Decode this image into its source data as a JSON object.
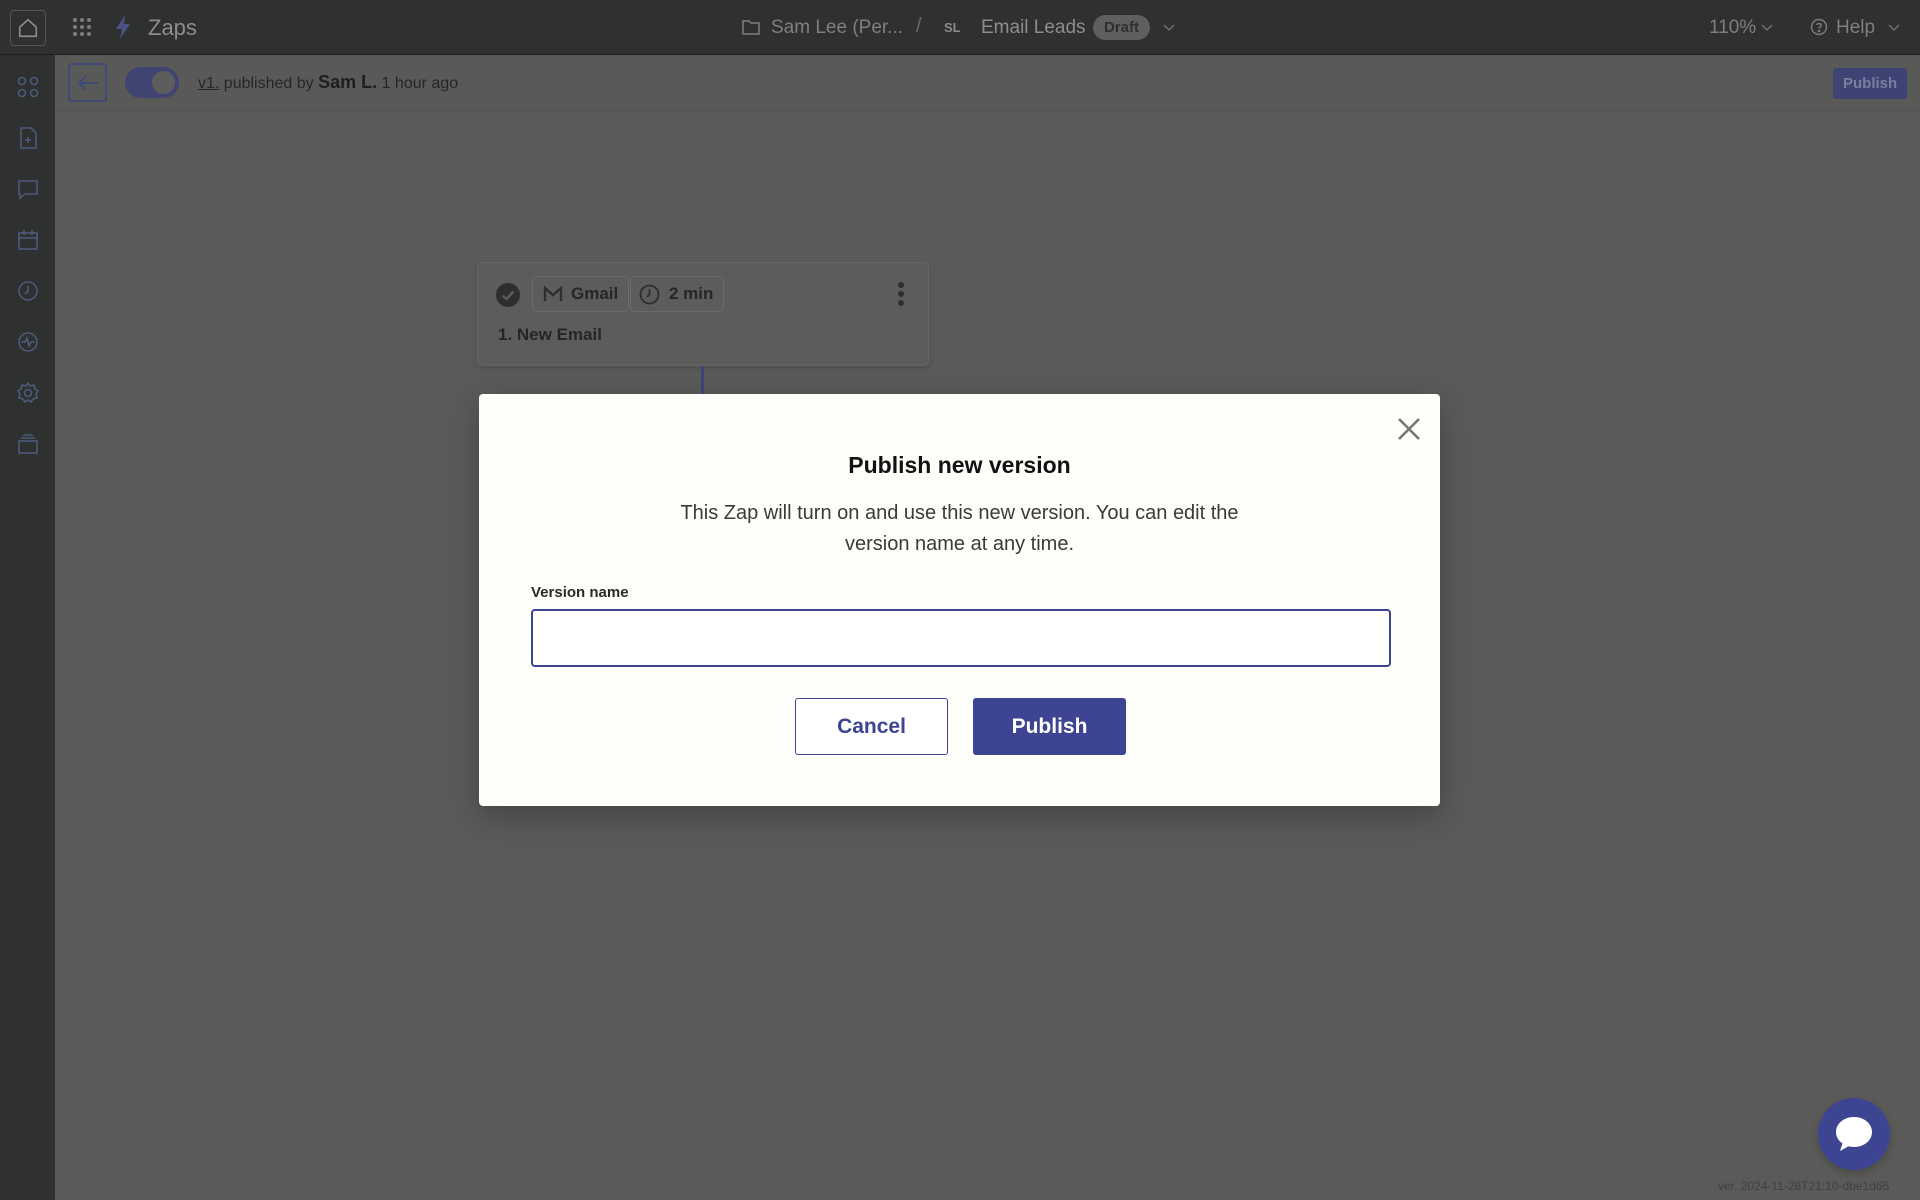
{
  "topbar": {
    "app_title": "Zaps",
    "breadcrumb_folder": "Sam Lee (Per...",
    "separator": "/",
    "owner_initials": "SL",
    "zap_name": "Email Leads",
    "status_badge": "Draft",
    "zoom": "110%",
    "help_label": "Help"
  },
  "subbar": {
    "version_link": "v1.",
    "published_by": "published by",
    "user": "Sam L.",
    "time_ago": "1 hour ago",
    "publish_label": "Publish"
  },
  "step": {
    "app": "Gmail",
    "duration": "2 min",
    "title": "1. New Email"
  },
  "modal": {
    "title": "Publish new version",
    "description": "This Zap will turn on and use this new version. You can edit the version name at any time.",
    "field_label": "Version name",
    "field_value": "",
    "cancel_label": "Cancel",
    "publish_label": "Publish"
  },
  "footer": {
    "version": "ver. 2024-11-28T21:10-dbe1d65"
  },
  "colors": {
    "accent": "#3d4592",
    "modal_bg": "#fdfdf9",
    "overlay": "#5a5a58"
  }
}
